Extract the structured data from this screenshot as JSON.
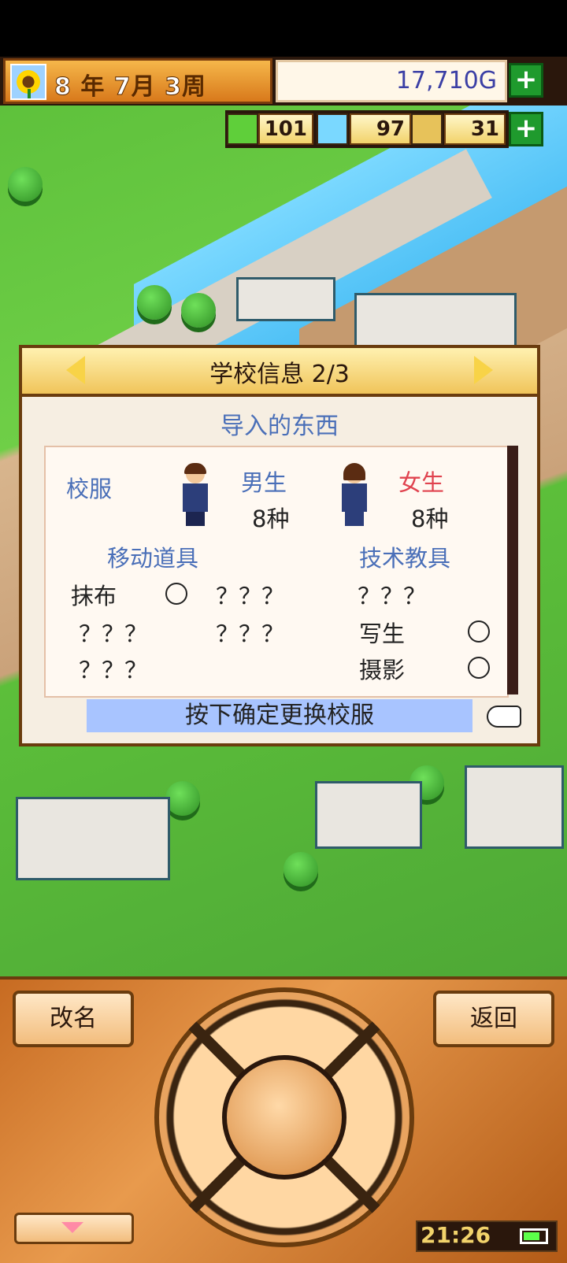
{
  "header": {
    "date": {
      "year": "8",
      "year_unit": "年",
      "month": "7",
      "month_unit": "月",
      "week": "3",
      "week_unit": "周"
    },
    "money": "17,710G",
    "resources": {
      "pencil": "101",
      "flask": "97",
      "trophy": "31"
    }
  },
  "dialog": {
    "title": "学校信息 2/3",
    "subtitle": "导入的东西",
    "uniform": {
      "label": "校服",
      "male_label": "男生",
      "male_count": "8种",
      "female_label": "女生",
      "female_count": "8种"
    },
    "mobile_tools": {
      "label": "移动道具",
      "items": [
        {
          "name": "抹布",
          "status": "○"
        },
        {
          "name": "？？？"
        },
        {
          "name": "？？？"
        },
        {
          "name": "？？？"
        },
        {
          "name": "？？？"
        }
      ]
    },
    "tech_tools": {
      "label": "技术教具",
      "items": [
        {
          "name": "？？？"
        },
        {
          "name": "写生",
          "status": "○"
        },
        {
          "name": "摄影",
          "status": "○"
        }
      ]
    },
    "confirm_text": "按下确定更换校服"
  },
  "controls": {
    "rename": "改名",
    "back": "返回",
    "clock": "21:26"
  },
  "colors": {
    "accent_blue": "#4a6fb8",
    "accent_red": "#e0434f",
    "panel_brown": "#6a3c0e"
  }
}
